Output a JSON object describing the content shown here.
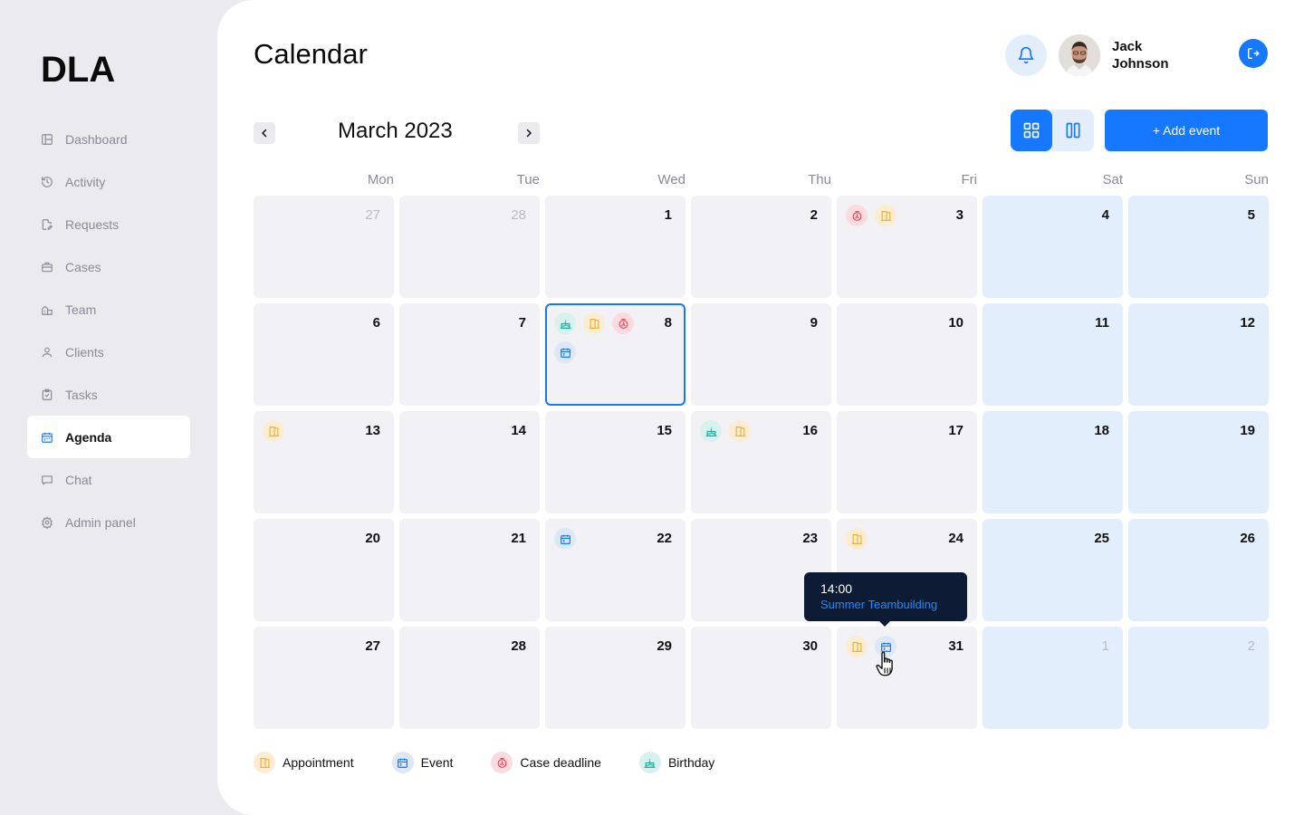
{
  "app": {
    "logo": "DLA"
  },
  "sidebar": {
    "items": [
      {
        "label": "Dashboard",
        "icon": "layout-icon"
      },
      {
        "label": "Activity",
        "icon": "history-icon"
      },
      {
        "label": "Requests",
        "icon": "file-edit-icon"
      },
      {
        "label": "Cases",
        "icon": "briefcase-icon"
      },
      {
        "label": "Team",
        "icon": "team-icon"
      },
      {
        "label": "Clients",
        "icon": "user-icon"
      },
      {
        "label": "Tasks",
        "icon": "clipboard-check-icon"
      },
      {
        "label": "Agenda",
        "icon": "calendar-icon",
        "active": true
      },
      {
        "label": "Chat",
        "icon": "chat-icon"
      },
      {
        "label": "Admin panel",
        "icon": "settings-icon"
      }
    ]
  },
  "header": {
    "title": "Calendar",
    "user": {
      "first_name": "Jack",
      "last_name": "Johnson"
    }
  },
  "toolbar": {
    "month_label": "March 2023",
    "add_event_label": "+ Add event",
    "active_view": "month-grid"
  },
  "calendar": {
    "weekdays": [
      "Mon",
      "Tue",
      "Wed",
      "Thu",
      "Fri",
      "Sat",
      "Sun"
    ],
    "selected_day": 8,
    "weeks": [
      [
        {
          "day": "27",
          "other": true,
          "events": []
        },
        {
          "day": "28",
          "other": true,
          "events": []
        },
        {
          "day": "1",
          "events": []
        },
        {
          "day": "2",
          "events": []
        },
        {
          "day": "3",
          "events": [
            "deadline",
            "appointment"
          ]
        },
        {
          "day": "4",
          "events": []
        },
        {
          "day": "5",
          "events": []
        }
      ],
      [
        {
          "day": "6",
          "events": []
        },
        {
          "day": "7",
          "events": []
        },
        {
          "day": "8",
          "selected": true,
          "events": [
            "birthday",
            "appointment",
            "deadline",
            "event"
          ]
        },
        {
          "day": "9",
          "events": []
        },
        {
          "day": "10",
          "events": []
        },
        {
          "day": "11",
          "events": []
        },
        {
          "day": "12",
          "events": []
        }
      ],
      [
        {
          "day": "13",
          "events": [
            "appointment"
          ]
        },
        {
          "day": "14",
          "events": []
        },
        {
          "day": "15",
          "events": []
        },
        {
          "day": "16",
          "events": [
            "birthday",
            "appointment"
          ]
        },
        {
          "day": "17",
          "events": []
        },
        {
          "day": "18",
          "events": []
        },
        {
          "day": "19",
          "events": []
        }
      ],
      [
        {
          "day": "20",
          "events": []
        },
        {
          "day": "21",
          "events": []
        },
        {
          "day": "22",
          "events": [
            "event"
          ]
        },
        {
          "day": "23",
          "events": []
        },
        {
          "day": "24",
          "events": [
            "appointment"
          ]
        },
        {
          "day": "25",
          "events": []
        },
        {
          "day": "26",
          "events": []
        }
      ],
      [
        {
          "day": "27",
          "events": []
        },
        {
          "day": "28",
          "events": []
        },
        {
          "day": "29",
          "events": []
        },
        {
          "day": "30",
          "events": []
        },
        {
          "day": "31",
          "events": [
            "appointment",
            "event"
          ]
        },
        {
          "day": "1",
          "other": true,
          "events": []
        },
        {
          "day": "2",
          "other": true,
          "events": []
        }
      ]
    ]
  },
  "tooltip": {
    "time": "14:00",
    "title": "Summer Teambuilding"
  },
  "legend": [
    {
      "type": "appointment",
      "label": "Appointment"
    },
    {
      "type": "event",
      "label": "Event"
    },
    {
      "type": "deadline",
      "label": "Case deadline"
    },
    {
      "type": "birthday",
      "label": "Birthday"
    }
  ],
  "colors": {
    "accent": "#1677ff",
    "appointment": "#e8b33a",
    "event": "#1677ff",
    "deadline": "#ef4b5a",
    "birthday": "#17b3a3",
    "weekend_bg": "#e3eefc",
    "weekday_bg": "#f2f2f6"
  }
}
